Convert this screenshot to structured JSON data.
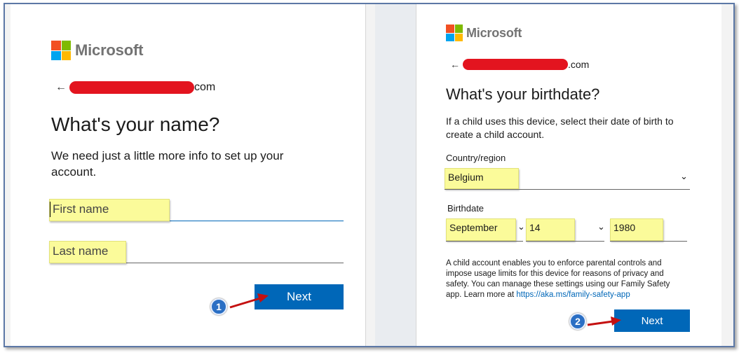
{
  "left": {
    "logo_text": "Microsoft",
    "email_suffix": "com",
    "heading": "What's your name?",
    "description": "We need just a little more info to set up your account.",
    "first_name_placeholder": "First name",
    "last_name_placeholder": "Last name",
    "next_label": "Next",
    "badge": "1"
  },
  "right": {
    "logo_text": "Microsoft",
    "email_suffix": ".com",
    "heading": "What's your birthdate?",
    "description": "If a child uses this device, select their date of birth to create a child account.",
    "country_label": "Country/region",
    "country_value": "Belgium",
    "birthdate_label": "Birthdate",
    "month_value": "September",
    "day_value": "14",
    "year_value": "1980",
    "info_text": "A child account enables you to enforce parental controls and impose usage limits for this device for reasons of privacy and safety. You can manage these settings using our Family Safety app. Learn more at ",
    "info_link": "https://aka.ms/family-safety-app",
    "next_label": "Next",
    "badge": "2"
  },
  "colors": {
    "ms_red": "#f25022",
    "ms_green": "#7fba00",
    "ms_blue": "#00a4ef",
    "ms_yellow": "#ffb900",
    "button_blue": "#0067b8",
    "highlight_yellow": "#fbfb9a",
    "redaction_red": "#e3141f"
  },
  "icons": [
    "microsoft-logo-icon",
    "back-arrow-icon",
    "chevron-down-icon",
    "red-arrow-annotation-icon"
  ]
}
